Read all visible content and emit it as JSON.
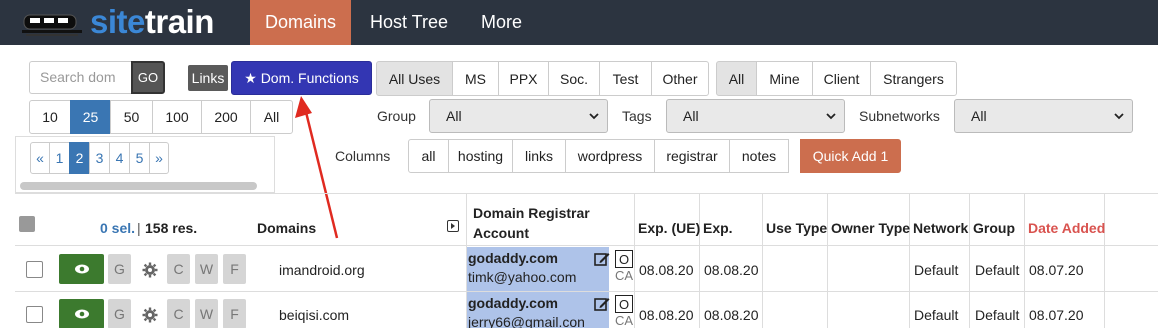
{
  "app": {
    "brand_part1": "site",
    "brand_part2": "train"
  },
  "nav": {
    "tabs": [
      {
        "label": "Domains",
        "active": true
      },
      {
        "label": "Host Tree"
      },
      {
        "label": "More"
      }
    ]
  },
  "toolbar": {
    "search_placeholder": "Search dom",
    "go_label": "GO",
    "links_label": "Links",
    "dom_functions_label": "★ Dom. Functions",
    "uses": [
      "All Uses",
      "MS",
      "PPX",
      "Soc.",
      "Test",
      "Other"
    ],
    "uses_active": "All Uses",
    "owners": [
      "All",
      "Mine",
      "Client",
      "Strangers"
    ],
    "owners_active": "All",
    "per_page": [
      "10",
      "25",
      "50",
      "100",
      "200",
      "All"
    ],
    "per_page_active": "25",
    "group_label": "Group",
    "group_value": "All",
    "tags_label": "Tags",
    "tags_value": "All",
    "subnetworks_label": "Subnetworks",
    "subnetworks_value": "All",
    "columns_label": "Columns",
    "columns": [
      "all",
      "hosting",
      "links",
      "wordpress",
      "registrar",
      "notes"
    ],
    "quick_add_label": "Quick Add 1"
  },
  "pager": {
    "items": [
      "«",
      "1",
      "2",
      "3",
      "4",
      "5",
      "»"
    ],
    "active": "2"
  },
  "table": {
    "selected": "0 sel.",
    "separator": "|",
    "results": "158 res.",
    "headers": {
      "domains": "Domains",
      "registrar_line1": "Domain Registrar",
      "registrar_line2": "Account",
      "exp_ue": "Exp. (UE)",
      "exp": "Exp.",
      "use_type": "Use Type",
      "owner_type": "Owner Type",
      "network": "Network",
      "group": "Group",
      "date_added": "Date Added"
    },
    "action_letters": {
      "g": "G",
      "c": "C",
      "w": "W",
      "f": "F"
    },
    "rows": [
      {
        "domain": "imandroid.org",
        "registrar": "godaddy.com",
        "account": "timk@yahoo.com",
        "o": "O",
        "ca": "CA",
        "exp_ue": "08.08.20",
        "exp": "08.08.20",
        "use_type": "",
        "owner_type": "",
        "network": "Default",
        "group": "Default",
        "date_added": "08.07.20"
      },
      {
        "domain": "beiqisi.com",
        "registrar": "godaddy.com",
        "account": "jerry66@gmail.con",
        "o": "O",
        "ca": "CA",
        "exp_ue": "08.08.20",
        "exp": "08.08.20",
        "use_type": "",
        "owner_type": "",
        "network": "Default",
        "group": "Default",
        "date_added": "08.07.20"
      }
    ]
  },
  "colors": {
    "nav_bg": "#2c3440",
    "accent_orange": "#cc6e4e",
    "accent_blue": "#3336b3",
    "link_blue": "#3a76b3",
    "eye_green": "#3c7a2e",
    "registrar_bg": "#aec3e9",
    "date_red": "#d9534f",
    "arrow_red": "#e02a20"
  }
}
